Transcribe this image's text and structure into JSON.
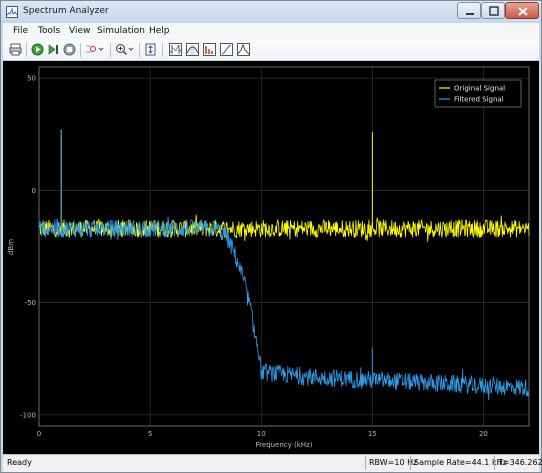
{
  "window": {
    "title": "Spectrum Analyzer"
  },
  "menu": [
    "File",
    "Tools",
    "View",
    "Simulation",
    "Help"
  ],
  "toolbar": {
    "icons": [
      "print-icon",
      "run-icon",
      "step-forward-icon",
      "stop-icon",
      "highlight-signal-icon",
      "zoom-in-icon",
      "fit-to-view-icon",
      "cursor-measurements-icon",
      "channel-measurements-icon",
      "distortion-measurements-icon",
      "cumulative-measurements-icon",
      "peak-finder-icon"
    ]
  },
  "status": {
    "ready": "Ready",
    "rbw": "RBW=10 Hz",
    "sample_rate": "Sample Rate=44.1 kHz",
    "time": "T=346.262"
  },
  "colors": {
    "original": "#ffff00",
    "filtered": "#2d9be6",
    "background": "#000000",
    "grid": "#3a3a3a"
  },
  "chart_data": {
    "type": "line",
    "xlabel": "Frequency (kHz)",
    "ylabel": "dBm",
    "xlim": [
      0,
      22.05
    ],
    "ylim": [
      -105,
      55
    ],
    "xticks": [
      "0",
      "5",
      "10",
      "15",
      "20"
    ],
    "yticks": [
      "50",
      "0",
      "-50",
      "-100"
    ],
    "grid": true,
    "legend_position": "top-right",
    "legend": [
      "Original Signal",
      "Filtered Signal"
    ],
    "series": [
      {
        "name": "Original Signal",
        "x": [
          0,
          1,
          2,
          3,
          4,
          5,
          6,
          7,
          8,
          9,
          10,
          11,
          12,
          13,
          14,
          15,
          16,
          17,
          18,
          19,
          20,
          21,
          22
        ],
        "y": [
          -17,
          -17,
          -17,
          -17,
          -17,
          -17,
          -17,
          -17,
          -17,
          -17,
          -17,
          -17,
          -17,
          -17,
          -17,
          -17,
          -17,
          -17,
          -17,
          -17,
          -17,
          -17,
          -17
        ],
        "noise_range_db": 4,
        "peaks": [
          {
            "x": 1.0,
            "y": 27
          },
          {
            "x": 15.0,
            "y": 26
          }
        ]
      },
      {
        "name": "Filtered Signal",
        "x": [
          0,
          1,
          2,
          3,
          4,
          5,
          6,
          7,
          8,
          8.4,
          8.8,
          9.2,
          9.5,
          9.7,
          9.9,
          10.0,
          11,
          12,
          13,
          14,
          15,
          16,
          17,
          18,
          19,
          20,
          21,
          22
        ],
        "y": [
          -17,
          -17,
          -17,
          -17,
          -17,
          -17,
          -17,
          -17,
          -17,
          -20,
          -28,
          -40,
          -52,
          -63,
          -74,
          -81,
          -82,
          -83,
          -83.5,
          -84,
          -84.5,
          -85,
          -85.5,
          -86,
          -86.5,
          -87,
          -87.5,
          -88
        ],
        "noise_range_db": 4,
        "peaks": [
          {
            "x": 1.0,
            "y": 27
          },
          {
            "x": 15.0,
            "y": -70
          }
        ]
      }
    ]
  }
}
